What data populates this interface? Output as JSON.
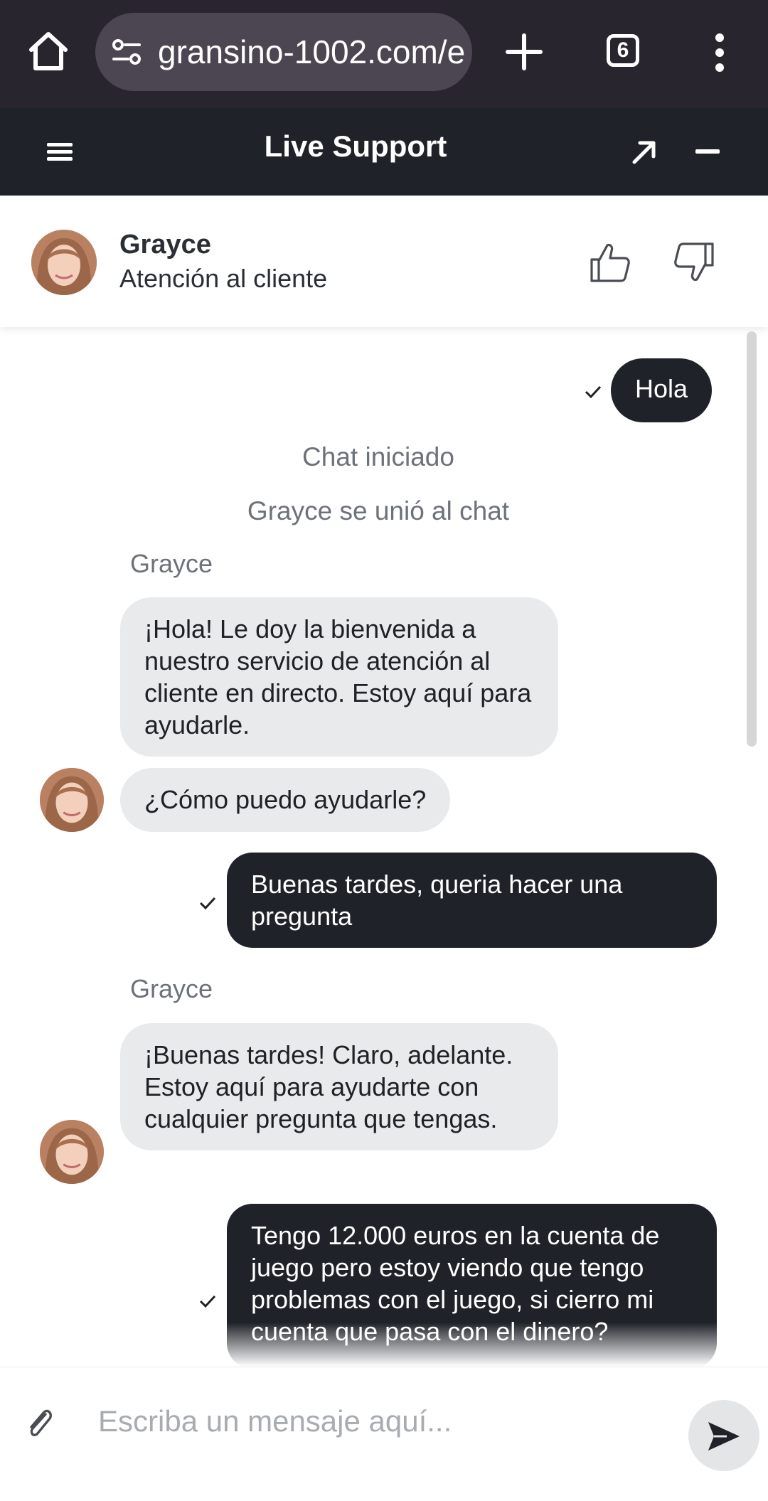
{
  "browser": {
    "url": "gransino-1002.com/e",
    "tab_count": "6"
  },
  "header": {
    "title": "Live Support"
  },
  "agent": {
    "name": "Grayce",
    "role": "Atención al cliente"
  },
  "messages": [
    {
      "from": "user",
      "text": "Hola"
    },
    {
      "type": "system",
      "text": "Chat iniciado"
    },
    {
      "type": "system",
      "text": "Grayce se unió al chat"
    },
    {
      "from": "agent",
      "sender": "Grayce",
      "text": "¡Hola! Le doy la bienvenida a nuestro servicio de atención al cliente en directo. Estoy aquí para ayudarle."
    },
    {
      "from": "agent",
      "text": "¿Cómo puedo ayudarle?"
    },
    {
      "from": "user",
      "text": "Buenas tardes, queria hacer una pregunta"
    },
    {
      "from": "agent",
      "sender": "Grayce",
      "text": "¡Buenas tardes! Claro, adelante. Estoy aquí para ayudarte con cualquier pregunta que tengas."
    },
    {
      "from": "user",
      "text": "Tengo 12.000 euros en la cuenta de juego pero estoy viendo que tengo problemas con el juego, si cierro mi cuenta que pasa con el dinero?"
    }
  ],
  "composer": {
    "placeholder": "Escriba un mensaje aquí..."
  },
  "colors": {
    "browser_bar": "#29252f",
    "header_bg": "#1f2329",
    "user_bubble": "#1f2329",
    "agent_bubble": "#e9eaec"
  }
}
